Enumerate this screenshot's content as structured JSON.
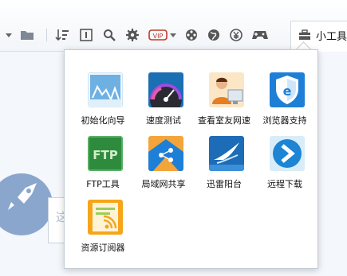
{
  "toolbar": {
    "items": [
      {
        "name": "dropdown-caret-icon"
      },
      {
        "name": "folder-icon"
      },
      {
        "name": "sort-icon"
      },
      {
        "name": "file-number-icon"
      },
      {
        "name": "search-icon"
      },
      {
        "name": "gear-icon"
      },
      {
        "name": "vip-icon"
      },
      {
        "name": "film-reel-icon"
      },
      {
        "name": "globe-icon"
      },
      {
        "name": "yuan-icon"
      },
      {
        "name": "gamepad-icon"
      }
    ],
    "tools_label": "小工具"
  },
  "popup": {
    "tools": [
      {
        "label": "初始化向导",
        "icon": "setup-wizard-icon"
      },
      {
        "label": "速度测试",
        "icon": "speedometer-icon"
      },
      {
        "label": "查看室友网速",
        "icon": "roommate-speed-icon"
      },
      {
        "label": "浏览器支持",
        "icon": "browser-support-icon"
      },
      {
        "label": "FTP工具",
        "icon": "ftp-icon"
      },
      {
        "label": "局域网共享",
        "icon": "lan-share-icon"
      },
      {
        "label": "迅雷阳台",
        "icon": "thunder-balcony-icon"
      },
      {
        "label": "远程下载",
        "icon": "remote-download-icon"
      },
      {
        "label": "资源订阅器",
        "icon": "rss-subscribe-icon"
      }
    ]
  },
  "colors": {
    "accent": "#3a86d6",
    "vip": "#c0392b"
  }
}
